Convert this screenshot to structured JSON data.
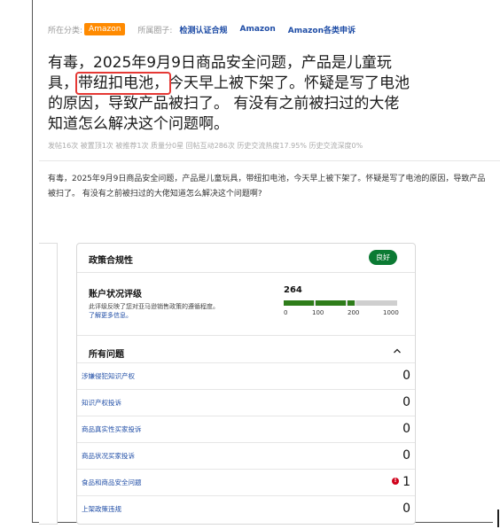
{
  "meta": {
    "category_label": "所在分类:",
    "category_tag": "Amazon",
    "circle_label": "所属圈子:",
    "circles": [
      "检测认证合规",
      "Amazon",
      "Amazon各类申诉"
    ]
  },
  "post": {
    "title_part1": "有毒，2025年9月9日商品安全问题，产品是儿童玩具，",
    "title_highlight": "带纽扣电池，",
    "title_part2": "今天早上被下架了。怀疑是写了电池的原因，导致产品被扫了。 有没有之前被扫过的大佬知道怎么解决这个问题啊。",
    "stats": "发帖16次 被置顶1次 被推荐1次 质量分0星 回帖互动286次 历史交流热度17.95% 历史交流深度0%",
    "body": "有毒，2025年9月9日商品安全问题，产品是儿童玩具，带纽扣电池，今天早上被下架了。怀疑是写了电池的原因，导致产品被扫了。 有没有之前被扫过的大佬知道怎么解决这个问题啊?"
  },
  "card": {
    "heading": "政策合规性",
    "badge": "良好",
    "badge_color": "#0b7a33",
    "account_status_title": "账户状况评级",
    "account_status_desc": "此评级反映了您对亚马逊销售政策的遵循程度。",
    "learn_more": "了解更多信息。",
    "score": "264",
    "score_value": 264,
    "scale_ticks": [
      "0",
      "100",
      "200",
      "1000"
    ],
    "issues_heading": "所有问题",
    "issues": [
      {
        "label": "涉嫌侵犯知识产权",
        "count": "0",
        "alert": false
      },
      {
        "label": "知识产权投诉",
        "count": "0",
        "alert": false
      },
      {
        "label": "商品真实性买家投诉",
        "count": "0",
        "alert": false
      },
      {
        "label": "商品状况买家投诉",
        "count": "0",
        "alert": false
      },
      {
        "label": "食品和商品安全问题",
        "count": "1",
        "alert": true
      },
      {
        "label": "上架政策违规",
        "count": "0",
        "alert": false
      }
    ]
  }
}
